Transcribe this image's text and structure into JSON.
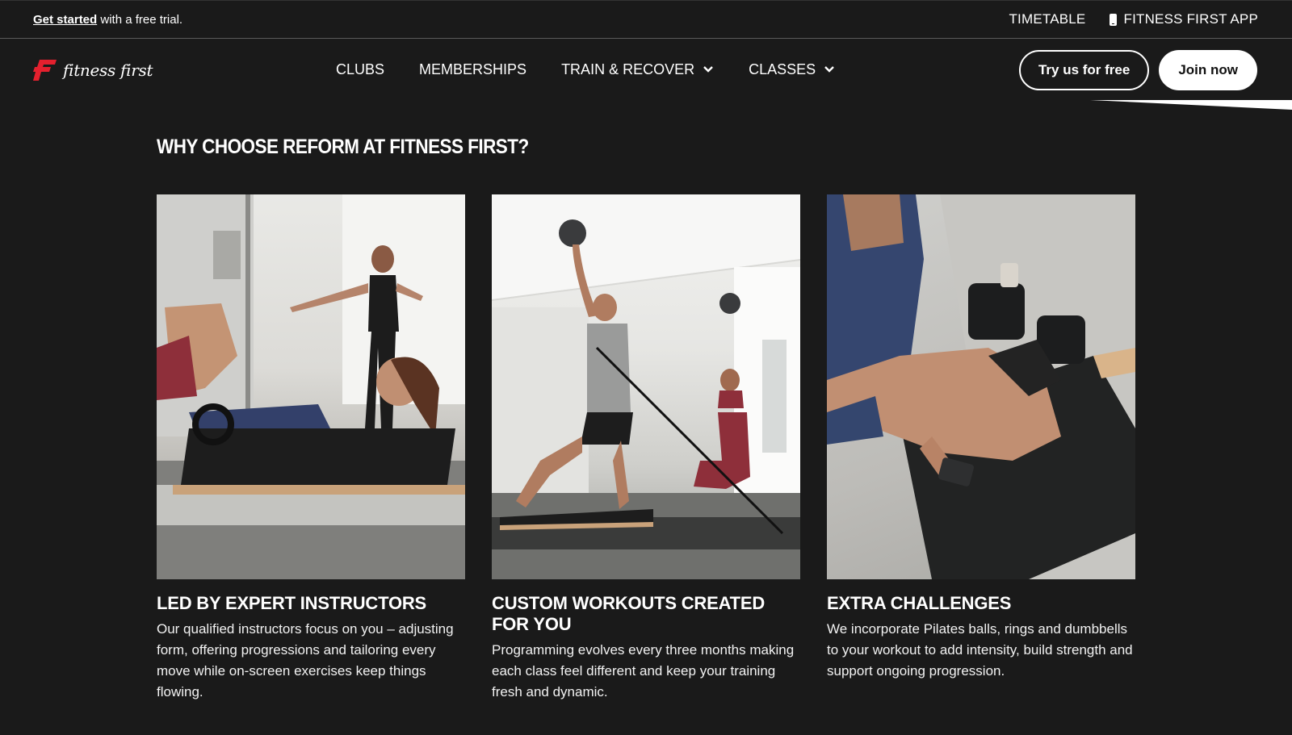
{
  "promo": {
    "link": "Get started",
    "text": " with a free trial."
  },
  "toplinks": {
    "timetable": "TIMETABLE",
    "app": "FITNESS FIRST APP"
  },
  "brand": {
    "name": "fitness first"
  },
  "nav": {
    "items": [
      {
        "label": "CLUBS",
        "has_dropdown": false
      },
      {
        "label": "MEMBERSHIPS",
        "has_dropdown": false
      },
      {
        "label": "TRAIN & RECOVER",
        "has_dropdown": true
      },
      {
        "label": "CLASSES",
        "has_dropdown": true
      }
    ],
    "try_label": "Try us for free",
    "join_label": "Join now"
  },
  "section": {
    "title": "WHY CHOOSE REFORM AT FITNESS FIRST?"
  },
  "cards": [
    {
      "title": "LED BY EXPERT INSTRUCTORS",
      "text": "Our qualified instructors focus on you – adjusting form, offering progressions and tailoring every move while on-screen exercises keep things flowing."
    },
    {
      "title": "CUSTOM WORKOUTS CREATED FOR YOU",
      "text": "Programming evolves every three months making each class feel different and keep your training fresh and dynamic."
    },
    {
      "title": "EXTRA CHALLENGES",
      "text": "We incorporate Pilates balls, rings and dumbbells to your workout to add intensity, build strength and support ongoing progression."
    }
  ],
  "colors": {
    "background": "#1a1a1a",
    "brand_red": "#e4202e",
    "text": "#ffffff"
  }
}
